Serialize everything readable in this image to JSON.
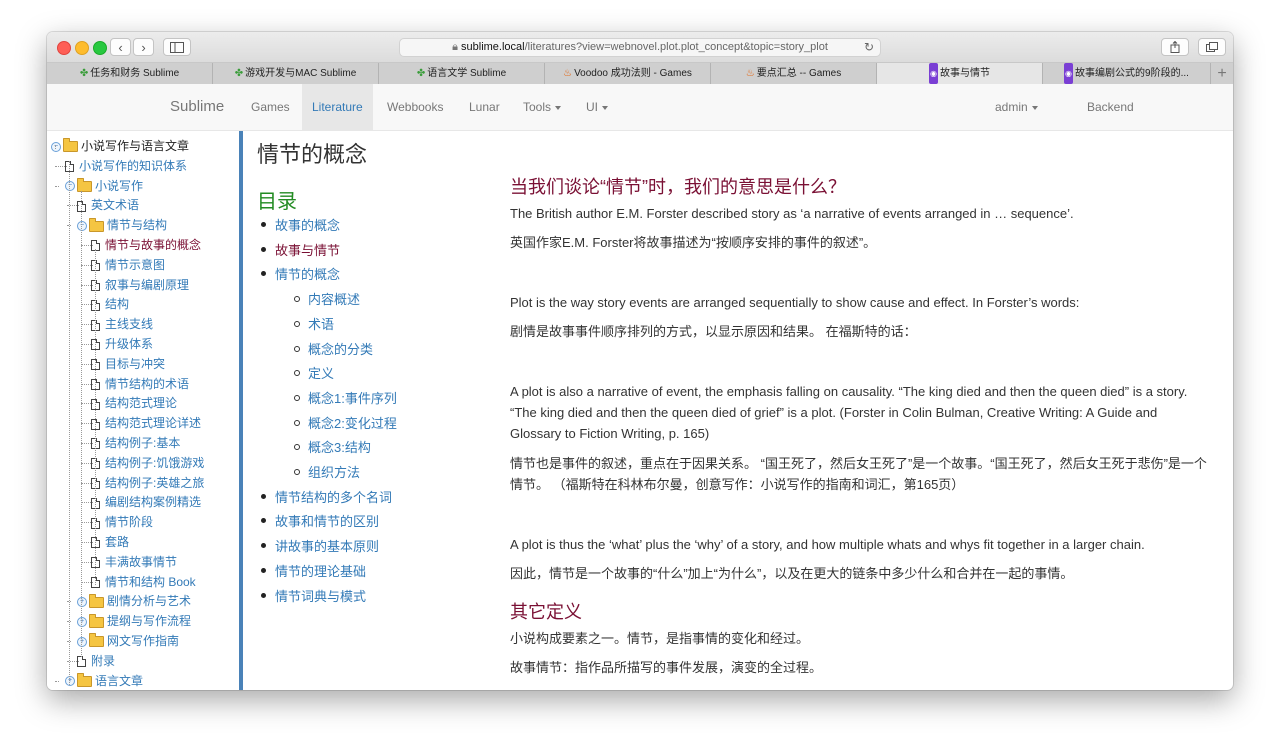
{
  "browser": {
    "url_host": "sublime.local",
    "url_path": "/literatures?view=webnovel.plot.plot_concept&topic=story_plot",
    "tabs": [
      {
        "label": "任务和财务 Sublime",
        "icon": "clover-icon"
      },
      {
        "label": "游戏开发与MAC Sublime",
        "icon": "clover-icon"
      },
      {
        "label": "语言文学 Sublime",
        "icon": "clover-icon"
      },
      {
        "label": "Voodoo 成功法则 - Games",
        "icon": "fire-icon"
      },
      {
        "label": "要点汇总 -- Games",
        "icon": "fire-icon"
      },
      {
        "label": "故事与情节",
        "icon": "app-icon",
        "active": true
      },
      {
        "label": "故事编剧公式的9阶段的...",
        "icon": "app-icon"
      }
    ]
  },
  "nav": {
    "brand": "Sublime",
    "items": [
      "Games",
      "Literature",
      "Webbooks",
      "Lunar",
      "Tools",
      "UI"
    ],
    "active": "Literature",
    "user": "admin",
    "backend": "Backend"
  },
  "tree": [
    {
      "label": "小说写作与语言文章",
      "type": "folder",
      "level": 0
    },
    {
      "label": "小说写作的知识体系",
      "type": "page",
      "level": 1
    },
    {
      "label": "小说写作",
      "type": "folder",
      "level": 1
    },
    {
      "label": "英文术语",
      "type": "page",
      "level": 2
    },
    {
      "label": "情节与结构",
      "type": "folder",
      "level": 2
    },
    {
      "label": "情节与故事的概念",
      "type": "page",
      "level": 3,
      "current": true
    },
    {
      "label": "情节示意图",
      "type": "page",
      "level": 3
    },
    {
      "label": "叙事与编剧原理",
      "type": "page",
      "level": 3
    },
    {
      "label": "结构",
      "type": "page",
      "level": 3
    },
    {
      "label": "主线支线",
      "type": "page",
      "level": 3
    },
    {
      "label": "升级体系",
      "type": "page",
      "level": 3
    },
    {
      "label": "目标与冲突",
      "type": "page",
      "level": 3
    },
    {
      "label": "情节结构的术语",
      "type": "page",
      "level": 3
    },
    {
      "label": "结构范式理论",
      "type": "page",
      "level": 3
    },
    {
      "label": "结构范式理论详述",
      "type": "page",
      "level": 3
    },
    {
      "label": "结构例子:基本",
      "type": "page",
      "level": 3
    },
    {
      "label": "结构例子:饥饿游戏",
      "type": "page",
      "level": 3
    },
    {
      "label": "结构例子:英雄之旅",
      "type": "page",
      "level": 3
    },
    {
      "label": "编剧结构案例精选",
      "type": "page",
      "level": 3
    },
    {
      "label": "情节阶段",
      "type": "page",
      "level": 3
    },
    {
      "label": "套路",
      "type": "page",
      "level": 3
    },
    {
      "label": "丰满故事情节",
      "type": "page",
      "level": 3
    },
    {
      "label": "情节和结构 Book",
      "type": "page",
      "level": 3
    },
    {
      "label": "剧情分析与艺术",
      "type": "folder-closed",
      "level": 2
    },
    {
      "label": "提纲与写作流程",
      "type": "folder-closed",
      "level": 2
    },
    {
      "label": "网文写作指南",
      "type": "folder-closed",
      "level": 2
    },
    {
      "label": "附录",
      "type": "page",
      "level": 2
    },
    {
      "label": "语言文章",
      "type": "folder-closed",
      "level": 1
    }
  ],
  "page": {
    "title": "情节的概念",
    "toc_heading": "目录",
    "toc": [
      {
        "label": "故事的概念",
        "level": 0
      },
      {
        "label": "故事与情节",
        "level": 0,
        "visited": true
      },
      {
        "label": "情节的概念",
        "level": 0
      },
      {
        "label": "内容概述",
        "level": 1
      },
      {
        "label": "术语",
        "level": 1
      },
      {
        "label": "概念的分类",
        "level": 1
      },
      {
        "label": "定义",
        "level": 1
      },
      {
        "label": "概念1:事件序列",
        "level": 1
      },
      {
        "label": "概念2:变化过程",
        "level": 1
      },
      {
        "label": "概念3:结构",
        "level": 1
      },
      {
        "label": "组织方法",
        "level": 1
      },
      {
        "label": "情节结构的多个名词",
        "level": 0
      },
      {
        "label": "故事和情节的区别",
        "level": 0
      },
      {
        "label": "讲故事的基本原则",
        "level": 0
      },
      {
        "label": "情节的理论基础",
        "level": 0
      },
      {
        "label": "情节词典与模式",
        "level": 0
      }
    ],
    "section1_heading": "当我们谈论“情节”时，我们的意思是什么？",
    "p1": "The British author E.M. Forster described story as ‘a narrative of events arranged in … sequence’.",
    "p2": "英国作家E.M. Forster将故事描述为“按顺序安排的事件的叙述”。",
    "p3": "Plot is the way story events are arranged sequentially to show cause and effect. In Forster’s words:",
    "p4": "剧情是故事事件顺序排列的方式，以显示原因和结果。 在福斯特的话：",
    "p5": "A plot is also a narrative of event, the emphasis falling on causality. “The king died and then the queen died” is a story. “The king died and then the queen died of grief” is a plot. (Forster in Colin Bulman, Creative Writing: A Guide and Glossary to Fiction Writing, p. 165)",
    "p6": "情节也是事件的叙述，重点在于因果关系。 “国王死了，然后女王死了”是一个故事。“国王死了，然后女王死于悲伤”是一个情节。 （福斯特在科林布尔曼，创意写作：小说写作的指南和词汇，第165页）",
    "p7": "A plot is thus the ‘what’ plus the ‘why’ of a story, and how multiple whats and whys fit together in a larger chain.",
    "p8": "因此，情节是一个故事的“什么”加上“为什么”，以及在更大的链条中多少什么和合并在一起的事情。",
    "section2_heading": "其它定义",
    "p9": "小说构成要素之一。情节，是指事情的变化和经过。",
    "p10": "故事情节：指作品所描写的事件发展，演变的全过程。"
  }
}
